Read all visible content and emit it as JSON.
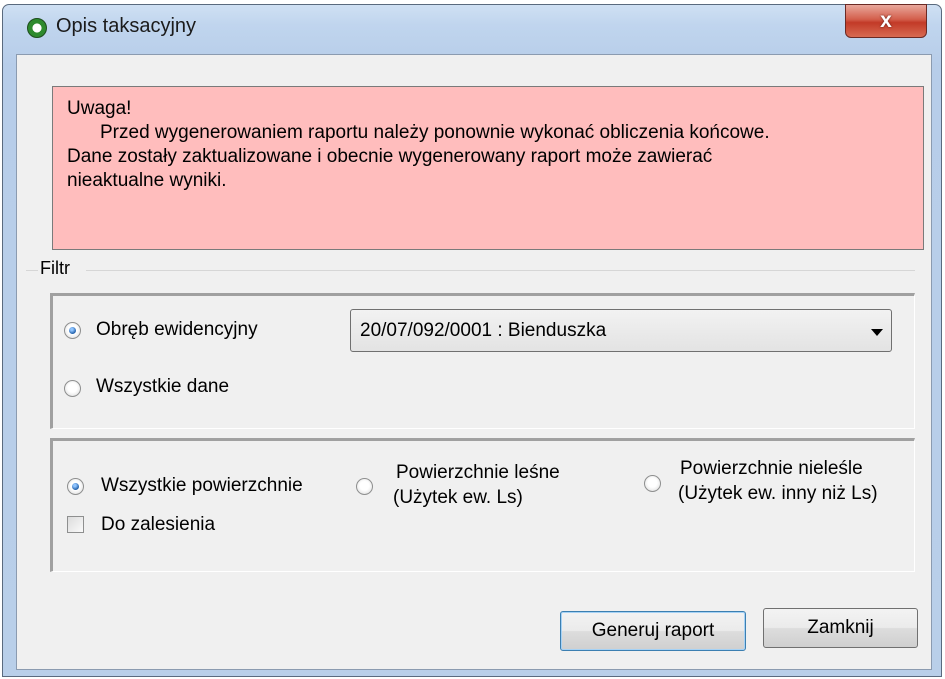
{
  "window": {
    "title": "Opis taksacyjny",
    "close_label": "x"
  },
  "warning": {
    "line1": "Uwaga!",
    "line2": "Przed wygenerowaniem raportu należy ponownie wykonać obliczenia końcowe.",
    "line3": "Dane zostały zaktualizowane i obecnie wygenerowany raport może zawierać",
    "line4": "nieaktualne wyniki.",
    "background": "#ffbdbd"
  },
  "filter": {
    "label": "Filtr",
    "scope": {
      "option1": "Obręb ewidencyjny",
      "option2": "Wszystkie dane",
      "selected": "option1",
      "combo_value": "20/07/092/0001 : Bienduszka"
    },
    "surface": {
      "option1": "Wszystkie powierzchnie",
      "option2_line1": "Powierzchnie leśne",
      "option2_line2": "(Użytek ew. Ls)",
      "option3_line1": "Powierzchnie nieleśle",
      "option3_line2": "(Użytek ew. inny niż Ls)",
      "selected": "option1",
      "checkbox_label": "Do zalesienia",
      "checkbox_checked": false
    }
  },
  "buttons": {
    "generate": "Generuj raport",
    "close": "Zamknij"
  }
}
